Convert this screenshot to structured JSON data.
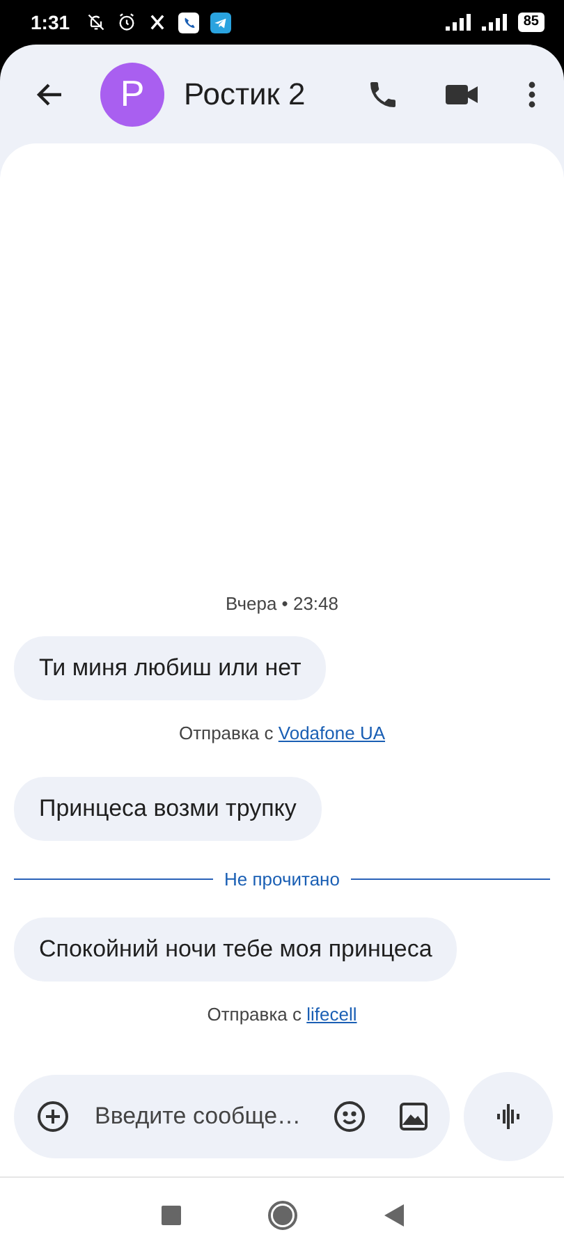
{
  "status_bar": {
    "time": "1:31",
    "battery": "85"
  },
  "header": {
    "avatar_letter": "P",
    "contact_name": "Ростик 2"
  },
  "messages": [
    {
      "kind": "timestamp",
      "text": "Вчера • 23:48"
    },
    {
      "kind": "incoming",
      "text": "Ти миня любиш или нет"
    },
    {
      "kind": "sent_via",
      "text": "Отправка с",
      "link": "Vodafone UA"
    },
    {
      "kind": "incoming",
      "text": "Принцеса возми трупку"
    },
    {
      "kind": "divider",
      "text": "Не прочитано"
    },
    {
      "kind": "incoming",
      "text": "Спокойний ночи тебе моя принцеса"
    },
    {
      "kind": "sent_via",
      "text": "Отправка с",
      "link": "lifecell"
    }
  ],
  "composer": {
    "placeholder": "Введите сообще…"
  }
}
